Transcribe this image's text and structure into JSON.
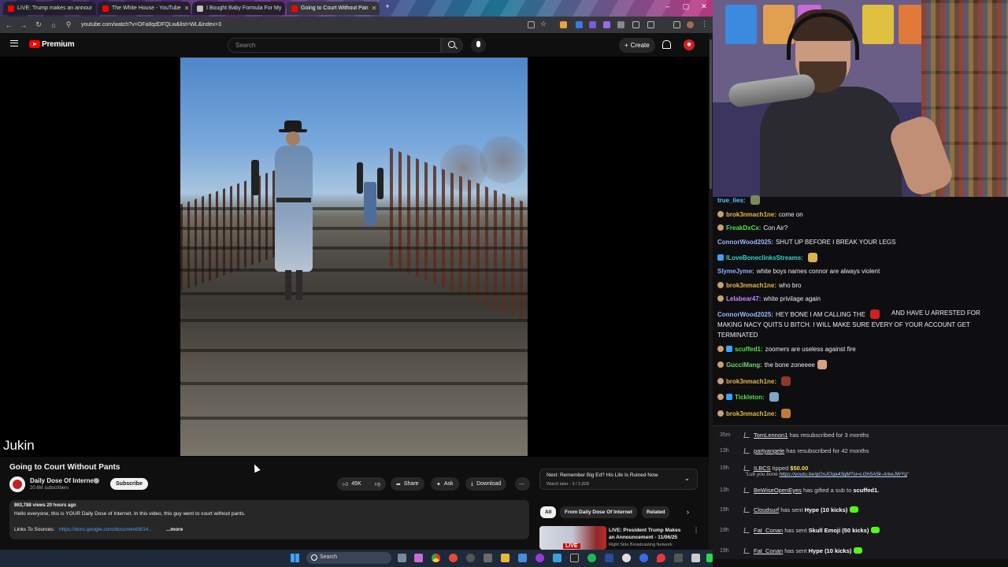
{
  "browser": {
    "tabs": [
      {
        "title": "LIVE: Trump makes an annour",
        "active": false
      },
      {
        "title": "The White House - YouTube",
        "active": false
      },
      {
        "title": "I Bought Baby Formula For My",
        "active": false
      },
      {
        "title": "Going to Court Without Pan",
        "active": true
      }
    ],
    "url": "youtube.com/watch?v=OFa8qdDFQLw&list=WL&index=3"
  },
  "youtube": {
    "brand": "Premium",
    "search_placeholder": "Search",
    "create_label": "Create",
    "video": {
      "watermark": "Jukin",
      "title": "Going to Court Without Pants",
      "channel": "Daily Dose Of Internet",
      "subscribers": "20.6M subscribers",
      "subscribe_label": "Subscribe",
      "likes": "45K",
      "share_label": "Share",
      "ask_label": "Ask",
      "download_label": "Download",
      "meta": "863,788 views  20 hours ago",
      "description": "Hello everyone, this is YOUR Daily Dose of Internet. In this video, this guy went to court without pants.",
      "links_label": "Links To Sources:",
      "links_url": "https://docs.google.com/document/d/14...",
      "more_label": "...more"
    },
    "next": {
      "label": "Next: Remember Big Ed? His Life Is Ruined Now.",
      "sub": "Watch later - 3 / 2,828"
    },
    "chips": [
      "All",
      "From Daily Dose Of Internet",
      "Related"
    ],
    "recommendation": {
      "title": "LIVE: President Trump Makes an Announcement - 11/06/25",
      "channel": "Right Side Broadcasting Network",
      "live_badge": "LIVE"
    }
  },
  "taskbar": {
    "search_label": "Search"
  },
  "chat": [
    {
      "user": "true_lies:",
      "color": "#4ec9ff",
      "text": "",
      "badge": "none",
      "emote": "#7a8a5a"
    },
    {
      "user": "brok3nmach1ne:",
      "color": "#e6b84a",
      "text": "come on",
      "badge": "gold"
    },
    {
      "user": "FreakDxCx:",
      "color": "#52e04a",
      "text": "Con Air?",
      "badge": "gold"
    },
    {
      "user": "ConnorWood2025:",
      "color": "#9ab6ff",
      "text": "SHUT UP BEFORE I BREAK YOUR LEGS",
      "badge": "none"
    },
    {
      "user": "ILoveBoneclinksStreams:",
      "color": "#2ad8c8",
      "text": "",
      "badge": "blue",
      "emote": "#d8b44a"
    },
    {
      "user": "SlymeJyme:",
      "color": "#8ab0ff",
      "text": "white boys names connor are always violent",
      "badge": "none"
    },
    {
      "user": "brok3nmach1ne:",
      "color": "#e6b84a",
      "text": "who bro",
      "badge": "gold"
    },
    {
      "user": "Lelabear47:",
      "color": "#c58aff",
      "text": "white privilage again",
      "badge": "gold"
    },
    {
      "user": "ConnorWood2025:",
      "color": "#9ab6ff",
      "text": "HEY BONE I AM CALLING THE",
      "badge": "none",
      "emote": "#c22"
    },
    {
      "user": "",
      "color": "#efeff1",
      "text": "AND HAVE U ARRESTED FOR",
      "badge": "none"
    },
    {
      "user": "",
      "color": "#efeff1",
      "text": "MAKING NACY QUITS U BITCH. I WILL MAKE SURE EVERY OF YOUR ACCOUNT GET",
      "badge": "none"
    },
    {
      "user": "",
      "color": "#efeff1",
      "text": "TERMINATED",
      "badge": "none"
    },
    {
      "user": "scuffed1:",
      "color": "#52e04a",
      "text": "zoomers are useless against fire",
      "badge": "goldblue"
    },
    {
      "user": "GucciMang:",
      "color": "#6fd86a",
      "text": "the bone zoneeee",
      "badge": "gold",
      "emote": "#d9a080"
    },
    {
      "user": "brok3nmach1ne:",
      "color": "#e6b84a",
      "text": "",
      "badge": "gold",
      "emote": "#8a3a2a"
    },
    {
      "user": "Tickleton:",
      "color": "#52e04a",
      "text": "",
      "badge": "goldblue",
      "emote": "#7aa8c8"
    },
    {
      "user": "brok3nmach1ne:",
      "color": "#e6b84a",
      "text": "",
      "badge": "gold",
      "emote": "#c07a3a"
    }
  ],
  "events": [
    {
      "time": "35m",
      "name": "TomLennon1",
      "text": " has resubscribed for 3 months"
    },
    {
      "time": "13h",
      "name": "partyangele",
      "text": " has resubscribed for 42 months"
    },
    {
      "time": "19h",
      "name": "ILBCS",
      "text": " tipped ",
      "bold": "$50.00",
      "quote": "\"Lub you bone ",
      "quote_link": "https://youtu.be/gOnJOqa43qM?si=LGh5A5k-ArkeJWYg",
      "quote_end": "\""
    },
    {
      "time": "13h",
      "name": "BeWiseOpenEyes",
      "text": " has gifted a sub to ",
      "bold": "scuffed1."
    },
    {
      "time": "19h",
      "name": "Cloudsurf",
      "text": " has sent ",
      "bold": "Hype (10 kicks)"
    },
    {
      "time": "19h",
      "name": "Fat_Conan",
      "text": " has sent ",
      "bold": "Skull Emoji (50 kicks)"
    },
    {
      "time": "19h",
      "name": "Fat_Conan",
      "text": " has sent ",
      "bold": "Hype (10 kicks)"
    }
  ]
}
